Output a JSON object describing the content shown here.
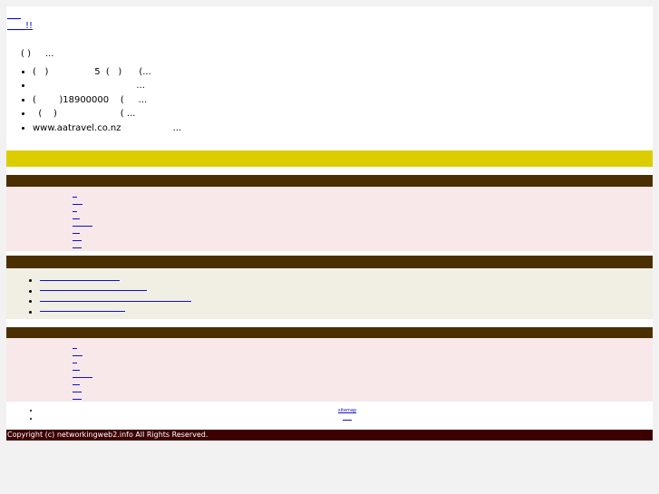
{
  "header": {
    "link_top": "___",
    "link_second": "____!!"
  },
  "intro": {
    "text": "( )     ..."
  },
  "snippets": [
    "(   )                5  (   )      (...",
    "                                    ...",
    "(        )18900000    (     ...",
    "  (    )                      ( ...",
    "www.aatravel.co.nz                  ..."
  ],
  "sections": {
    "yellow_bar": "",
    "brown_bar_1": "",
    "brown_bar_2": "",
    "brown_bar_3": ""
  },
  "footer": {
    "sitemap": "sitemap",
    "copyright": "Copyright (c) networkingweb2.info All Rights Reserved."
  }
}
